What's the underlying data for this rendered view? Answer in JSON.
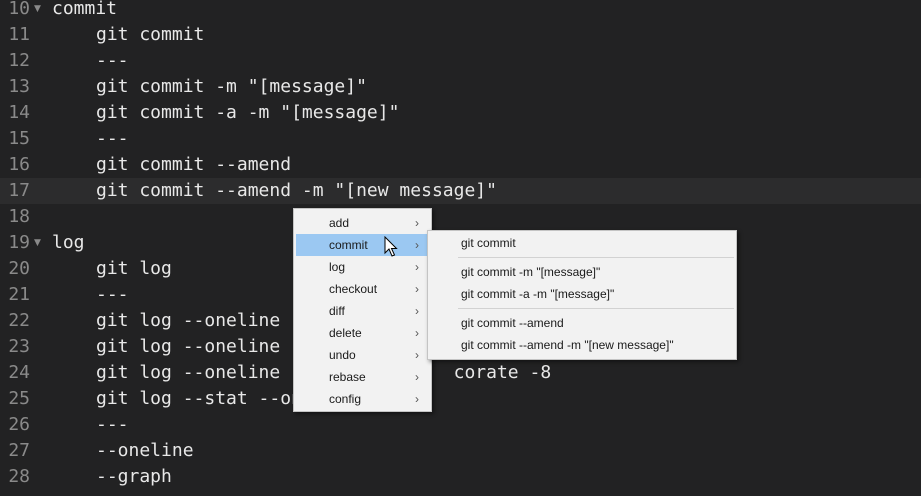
{
  "editor": {
    "lines": [
      {
        "n": "10",
        "text": "commit",
        "fold": true,
        "indent": false
      },
      {
        "n": "11",
        "text": "git commit",
        "indent": true
      },
      {
        "n": "12",
        "text": "---",
        "indent": true
      },
      {
        "n": "13",
        "text": "git commit -m \"[message]\"",
        "indent": true
      },
      {
        "n": "14",
        "text": "git commit -a -m \"[message]\"",
        "indent": true
      },
      {
        "n": "15",
        "text": "---",
        "indent": true
      },
      {
        "n": "16",
        "text": "git commit --amend",
        "indent": true
      },
      {
        "n": "17",
        "text": "git commit --amend -m \"[new message]\"",
        "indent": true,
        "current": true
      },
      {
        "n": "18",
        "text": "",
        "indent": false
      },
      {
        "n": "19",
        "text": "log",
        "fold": true,
        "indent": false
      },
      {
        "n": "20",
        "text": "git log",
        "indent": true
      },
      {
        "n": "21",
        "text": "---",
        "indent": true
      },
      {
        "n": "22",
        "text": "git log --oneline",
        "indent": true
      },
      {
        "n": "23",
        "text": "git log --oneline",
        "indent": true
      },
      {
        "n": "24",
        "text": "git log --oneline                corate -8",
        "indent": true
      },
      {
        "n": "25",
        "text": "git log --stat --oneline",
        "indent": true
      },
      {
        "n": "26",
        "text": "---",
        "indent": true
      },
      {
        "n": "27",
        "text": "--oneline",
        "indent": true
      },
      {
        "n": "28",
        "text": "--graph",
        "indent": true
      }
    ]
  },
  "context_menu": {
    "items": [
      {
        "label": "add"
      },
      {
        "label": "commit",
        "active": true
      },
      {
        "label": "log"
      },
      {
        "label": "checkout"
      },
      {
        "label": "diff"
      },
      {
        "label": "delete"
      },
      {
        "label": "undo"
      },
      {
        "label": "rebase"
      },
      {
        "label": "config"
      }
    ],
    "arrow_glyph": "›",
    "active_color": "#9bc8f2"
  },
  "submenu": {
    "groups": [
      [
        "git commit"
      ],
      [
        "git commit -m \"[message]\"",
        "git commit -a -m \"[message]\""
      ],
      [
        "git commit --amend",
        "git commit --amend -m \"[new message]\""
      ]
    ]
  }
}
